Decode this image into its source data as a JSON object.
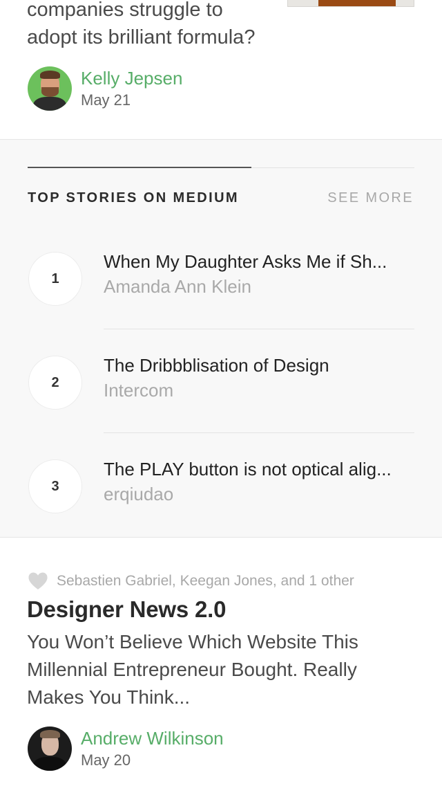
{
  "top_card": {
    "subtitle": "companies struggle to adopt its brilliant formula?",
    "author": {
      "name": "Kelly Jepsen",
      "date": "May 21"
    }
  },
  "top_stories": {
    "heading": "TOP STORIES ON MEDIUM",
    "see_more": "SEE MORE",
    "items": [
      {
        "rank": "1",
        "title": "When My Daughter Asks Me if Sh...",
        "author": "Amanda Ann Klein"
      },
      {
        "rank": "2",
        "title": "The Dribbblisation of Design",
        "author": "Intercom"
      },
      {
        "rank": "3",
        "title": "The PLAY button is not optical alig...",
        "author": "erqiudao"
      }
    ]
  },
  "bottom_card": {
    "recommended_by": "Sebastien Gabriel, Keegan Jones, and 1 other",
    "title": "Designer News 2.0",
    "subtitle": "You Won’t Believe Which Website This Millennial Entrepreneur Bought. Really Makes You Think...",
    "author": {
      "name": "Andrew Wilkinson",
      "date": "May 20"
    }
  },
  "colors": {
    "accent_green": "#57ad68",
    "module_background": "#f8f8f8",
    "muted_text": "#a8a8a8"
  },
  "icons": {
    "recommend": "heart-icon"
  }
}
